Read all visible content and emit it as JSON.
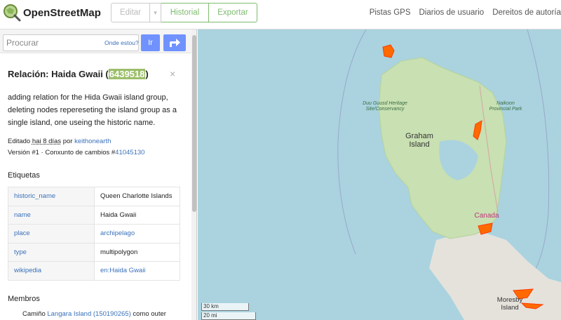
{
  "header": {
    "brand": "OpenStreetMap",
    "buttons": {
      "edit": "Editar",
      "caret": "▾",
      "history": "Historial",
      "export": "Exportar"
    },
    "nav": [
      "Pistas GPS",
      "Diarios de usuario",
      "Dereitos de autoría"
    ]
  },
  "search": {
    "placeholder": "Procurar",
    "where_am_i": "Onde estou?",
    "go": "Ir"
  },
  "relation": {
    "title_prefix": "Relación: Haida Gwaii (",
    "id": "6439518",
    "title_suffix": ")",
    "close": "×",
    "description": "adding relation for the Hida Gwaii island group, deleting nodes repereseting the island group as a single island, one useing the historic name.",
    "edited_prefix": "Editado ",
    "edited_when": "hai 8 días",
    "edited_by": " por ",
    "editor": "keithonearth",
    "version_prefix": "Versión #1 · Conxunto de cambios #",
    "changeset": "41045130",
    "tags_heading": "Etiquetas",
    "tags": [
      {
        "key": "historic_name",
        "value": "Queen Charlotte Islands",
        "link": false
      },
      {
        "key": "name",
        "value": "Haida Gwaii",
        "link": false
      },
      {
        "key": "place",
        "value": "archipelago",
        "link": true
      },
      {
        "key": "type",
        "value": "multipolygon",
        "link": false
      },
      {
        "key": "wikipedia",
        "value": "en:Haida Gwaii",
        "link": true
      }
    ],
    "members_heading": "Membros",
    "member": {
      "prefix": "Camiño ",
      "link": "Langara Island (150190265)",
      "suffix": " como outer"
    }
  },
  "map": {
    "labels": {
      "duu_guusd": "Duu Guusd Heritage Site/Conservancy",
      "naikoon": "Naikoon Provincial Park",
      "graham": "Graham Island",
      "canada": "Canada",
      "moresby": "Moresby Island"
    },
    "scale": {
      "km": "30 km",
      "mi": "20 mi"
    },
    "colors": {
      "water": "#aad3df",
      "land": "#f2efe9",
      "park": "#c8e0b2",
      "highlight": "#ff6a00"
    }
  },
  "icons": {
    "logo": "osm-magnifier-logo-icon",
    "directions": "directions-arrow-icon",
    "close": "close-icon"
  }
}
